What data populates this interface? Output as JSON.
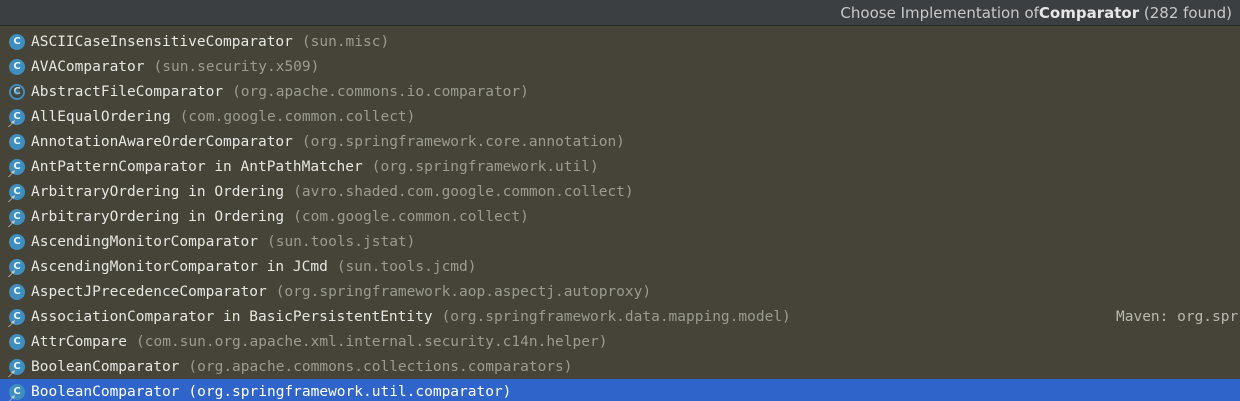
{
  "header": {
    "prefix": "Choose Implementation of ",
    "class_name": "Comparator",
    "count": "(282 found)"
  },
  "rows": [
    {
      "name": "ASCIICaseInsensitiveComparator",
      "pkg": "(sun.misc)",
      "icon": "class-icon",
      "badge": false
    },
    {
      "name": "AVAComparator",
      "pkg": "(sun.security.x509)",
      "icon": "class-icon",
      "badge": false
    },
    {
      "name": "AbstractFileComparator",
      "pkg": "(org.apache.commons.io.comparator)",
      "icon": "abstract-class-icon",
      "badge": false
    },
    {
      "name": "AllEqualOrdering",
      "pkg": "(com.google.common.collect)",
      "icon": "class-icon",
      "badge": true
    },
    {
      "name": "AnnotationAwareOrderComparator",
      "pkg": "(org.springframework.core.annotation)",
      "icon": "class-icon",
      "badge": false
    },
    {
      "name": "AntPatternComparator in AntPathMatcher",
      "pkg": "(org.springframework.util)",
      "icon": "class-icon",
      "badge": true
    },
    {
      "name": "ArbitraryOrdering in Ordering",
      "pkg": "(avro.shaded.com.google.common.collect)",
      "icon": "class-icon",
      "badge": true
    },
    {
      "name": "ArbitraryOrdering in Ordering",
      "pkg": "(com.google.common.collect)",
      "icon": "class-icon",
      "badge": true
    },
    {
      "name": "AscendingMonitorComparator",
      "pkg": "(sun.tools.jstat)",
      "icon": "class-icon",
      "badge": false
    },
    {
      "name": "AscendingMonitorComparator in JCmd",
      "pkg": "(sun.tools.jcmd)",
      "icon": "class-icon",
      "badge": true
    },
    {
      "name": "AspectJPrecedenceComparator",
      "pkg": "(org.springframework.aop.aspectj.autoproxy)",
      "icon": "class-icon",
      "badge": false
    },
    {
      "name": "AssociationComparator in BasicPersistentEntity",
      "pkg": "(org.springframework.data.mapping.model)",
      "icon": "class-icon",
      "badge": true,
      "right": "Maven: org.spr"
    },
    {
      "name": "AttrCompare",
      "pkg": "(com.sun.org.apache.xml.internal.security.c14n.helper)",
      "icon": "class-icon",
      "badge": false
    },
    {
      "name": "BooleanComparator",
      "pkg": "(org.apache.commons.collections.comparators)",
      "icon": "class-icon",
      "badge": true
    },
    {
      "name": "BooleanComparator",
      "pkg": "(org.springframework.util.comparator)",
      "icon": "class-icon",
      "badge": true,
      "selected": true
    }
  ],
  "icon_letter": "C",
  "colors": {
    "background": "#464438",
    "selection": "#2f65ca",
    "class_icon": "#3e8fbf"
  }
}
